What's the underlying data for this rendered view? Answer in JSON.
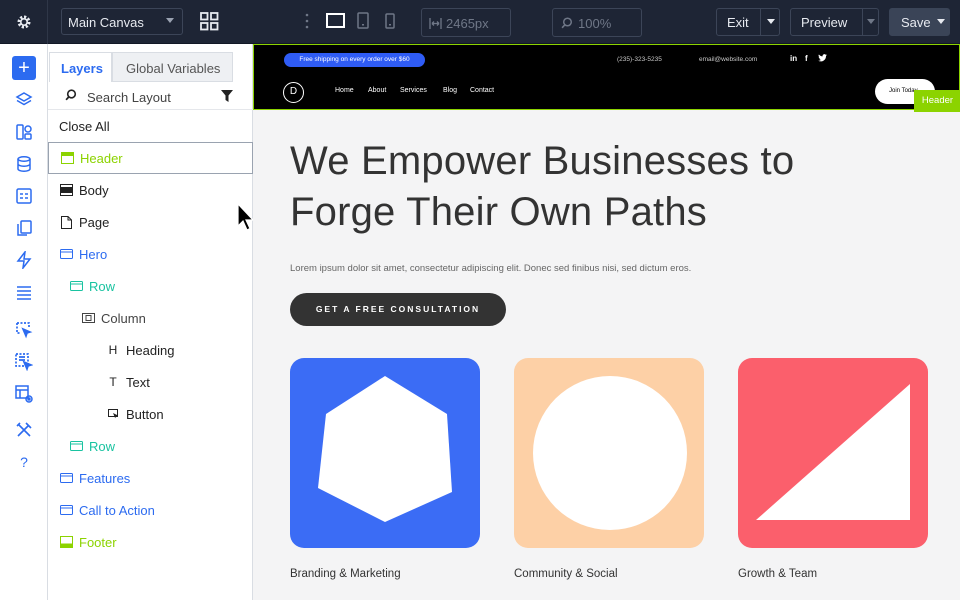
{
  "toolbar": {
    "canvas_select": "Main Canvas",
    "width_value": "2465px",
    "zoom_value": "100%",
    "exit_label": "Exit",
    "preview_label": "Preview",
    "save_label": "Save"
  },
  "rail": {
    "icons": [
      "add-icon",
      "layers-icon",
      "modules-icon",
      "database-icon",
      "page-settings-icon",
      "copy-icon",
      "lightning-icon",
      "list-icon",
      "select-icon",
      "multi-select-icon",
      "layout-preview-icon",
      "tools-icon",
      "help-icon"
    ]
  },
  "panel": {
    "tabs": [
      "Layers",
      "Global Variables"
    ],
    "search_placeholder": "Search Layout",
    "close_all": "Close All",
    "layers": [
      {
        "label": "Header",
        "icon": "header-icon",
        "color": "#8cd300"
      },
      {
        "label": "Body",
        "icon": "body-icon",
        "color": "#222222"
      },
      {
        "label": "Page",
        "icon": "page-icon",
        "color": "#222222"
      },
      {
        "label": "Hero",
        "icon": "section-icon",
        "color": "#2c6bf0"
      },
      {
        "label": "Row",
        "icon": "row-icon",
        "color": "#19c3a0"
      },
      {
        "label": "Column",
        "icon": "column-icon",
        "color": "#444444"
      },
      {
        "label": "Heading",
        "icon": "heading-icon",
        "color": "#222222"
      },
      {
        "label": "Text",
        "icon": "text-icon",
        "color": "#222222"
      },
      {
        "label": "Button",
        "icon": "button-icon",
        "color": "#222222"
      },
      {
        "label": "Row",
        "icon": "row-icon",
        "color": "#19c3a0"
      },
      {
        "label": "Features",
        "icon": "section-icon",
        "color": "#2c6bf0"
      },
      {
        "label": "Call to Action",
        "icon": "section-icon",
        "color": "#2c6bf0"
      },
      {
        "label": "Footer",
        "icon": "footer-icon",
        "color": "#8cd300"
      }
    ]
  },
  "canvas": {
    "shipping": "Free shipping on every order over $60",
    "phone": "(235)-323-5235",
    "email": "email@website.com",
    "logo": "D",
    "nav": [
      "Home",
      "About",
      "Services",
      "Blog",
      "Contact"
    ],
    "join": "Join Today",
    "header_tag": "Header",
    "headline": "We Empower Businesses to Forge Their Own Paths",
    "lead": "Lorem ipsum dolor sit amet, consectetur adipiscing elit. Donec sed finibus nisi, sed dictum eros.",
    "cta": "GET A FREE CONSULTATION",
    "cards": [
      {
        "label": "Branding & Marketing",
        "color": "#3b6cf5"
      },
      {
        "label": "Community & Social",
        "color": "#fdd0a6"
      },
      {
        "label": "Growth & Team",
        "color": "#fb5f6c"
      }
    ]
  },
  "colors": {
    "accent": "#2c6bf0",
    "header_green": "#8cd300",
    "row_teal": "#19c3a0",
    "topbar": "#1e2535"
  }
}
